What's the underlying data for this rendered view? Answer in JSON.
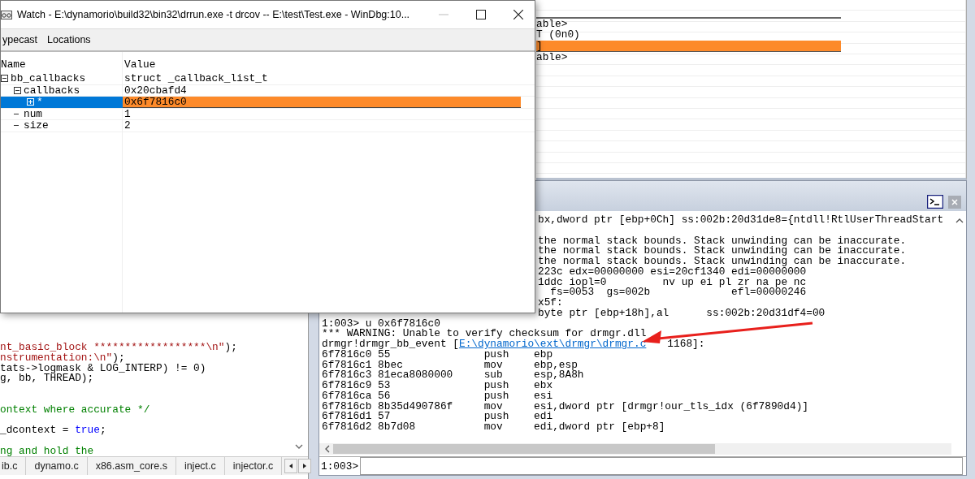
{
  "watch_window": {
    "title": "Watch - E:\\dynamorio\\build32\\bin32\\drrun.exe -t drcov -- E:\\test\\Test.exe - WinDbg:10...",
    "toolbar": [
      "ypecast",
      "Locations"
    ],
    "columns": [
      "Name",
      "Value"
    ],
    "rows": [
      {
        "name": "bb_callbacks",
        "value": "struct _callback_list_t",
        "expanded": true,
        "selected": false,
        "children": [
          {
            "name": "callbacks",
            "value": "0x20cbafd4",
            "expanded": true,
            "selected": false,
            "children": [
              {
                "name": "*",
                "value": "0x6f7816c0",
                "expanded": false,
                "selected": true
              }
            ]
          },
          {
            "name": "num",
            "value": "1",
            "selected": false
          },
          {
            "name": "size",
            "value": "2",
            "selected": false
          }
        ]
      }
    ]
  },
  "locals_pane": {
    "rows": [
      {
        "text": "able>",
        "selected": false
      },
      {
        "text": "T (0n0)",
        "selected": false
      },
      {
        "text": "]",
        "selected": true
      },
      {
        "text": "able>",
        "selected": false
      }
    ]
  },
  "source_pane": {
    "lines": [
      {
        "kind": "code",
        "segments": [
          {
            "kind": "string",
            "text": "nt_basic_block ******************\\n\""
          },
          {
            "kind": "plain",
            "text": ");"
          }
        ]
      },
      {
        "kind": "code",
        "segments": [
          {
            "kind": "string",
            "text": "nstrumentation:\\n\""
          },
          {
            "kind": "plain",
            "text": ");"
          }
        ]
      },
      {
        "kind": "code",
        "segments": [
          {
            "kind": "plain",
            "text": "tats->logmask & LOG_INTERP) != 0)"
          }
        ]
      },
      {
        "kind": "code",
        "segments": [
          {
            "kind": "plain",
            "text": "g, bb, THREAD);"
          }
        ]
      },
      {
        "kind": "blank"
      },
      {
        "kind": "blank"
      },
      {
        "kind": "code",
        "segments": [
          {
            "kind": "comment",
            "text": "ontext where accurate */"
          }
        ]
      },
      {
        "kind": "blank"
      },
      {
        "kind": "code",
        "segments": [
          {
            "kind": "plain",
            "text": "_dcontext = "
          },
          {
            "kind": "keyword",
            "text": "true"
          },
          {
            "kind": "plain",
            "text": ";"
          }
        ]
      },
      {
        "kind": "blank"
      },
      {
        "kind": "code",
        "segments": [
          {
            "kind": "comment",
            "text": "ng and hold the"
          }
        ]
      }
    ],
    "tabs": [
      "ib.c",
      "dynamo.c",
      "x86.asm_core.s",
      "inject.c",
      "injector.c"
    ]
  },
  "command_window": {
    "output": [
      {
        "kind": "covered",
        "text": "bx,dword ptr [ebp+0Ch] ss:002b:20d31de8={ntdll!RtlUserThreadStart"
      },
      {
        "kind": "blank"
      },
      {
        "kind": "covered",
        "text": "the normal stack bounds. Stack unwinding can be inaccurate."
      },
      {
        "kind": "covered",
        "text": "the normal stack bounds. Stack unwinding can be inaccurate."
      },
      {
        "kind": "covered",
        "text": "the normal stack bounds. Stack unwinding can be inaccurate."
      },
      {
        "kind": "covered",
        "text": "223c edx=00000000 esi=20cf1340 edi=00000000"
      },
      {
        "kind": "covered",
        "text": "1ddc iopl=0         nv up ei pl zr na pe nc"
      },
      {
        "kind": "covered",
        "text": "  fs=0053  gs=002b             efl=00000246"
      },
      {
        "kind": "covered",
        "text": "x5f:"
      },
      {
        "kind": "covered",
        "text": "byte ptr [ebp+18h],al      ss:002b:20d31df4=00"
      },
      {
        "kind": "plain",
        "text": "1:003> u 0x6f7816c0"
      },
      {
        "kind": "plain",
        "text": "*** WARNING: Unable to verify checksum for drmgr.dll"
      },
      {
        "kind": "link",
        "before": "drmgr!drmgr_bb_event [",
        "link": "E:\\dynamorio\\ext\\drmgr\\drmgr.c",
        "after": "1168]:"
      },
      {
        "kind": "plain",
        "text": "6f7816c0 55               push    ebp"
      },
      {
        "kind": "plain",
        "text": "6f7816c1 8bec             mov     ebp,esp"
      },
      {
        "kind": "plain",
        "text": "6f7816c3 81eca8080000     sub     esp,8A8h"
      },
      {
        "kind": "plain",
        "text": "6f7816c9 53               push    ebx"
      },
      {
        "kind": "plain",
        "text": "6f7816ca 56               push    esi"
      },
      {
        "kind": "plain",
        "text": "6f7816cb 8b35d490786f     mov     esi,dword ptr [drmgr!our_tls_idx (6f7890d4)]"
      },
      {
        "kind": "plain",
        "text": "6f7816d1 57               push    edi"
      },
      {
        "kind": "plain",
        "text": "6f7816d2 8b7d08           mov     edi,dword ptr [ebp+8]"
      }
    ],
    "prompt": "1:003>"
  }
}
